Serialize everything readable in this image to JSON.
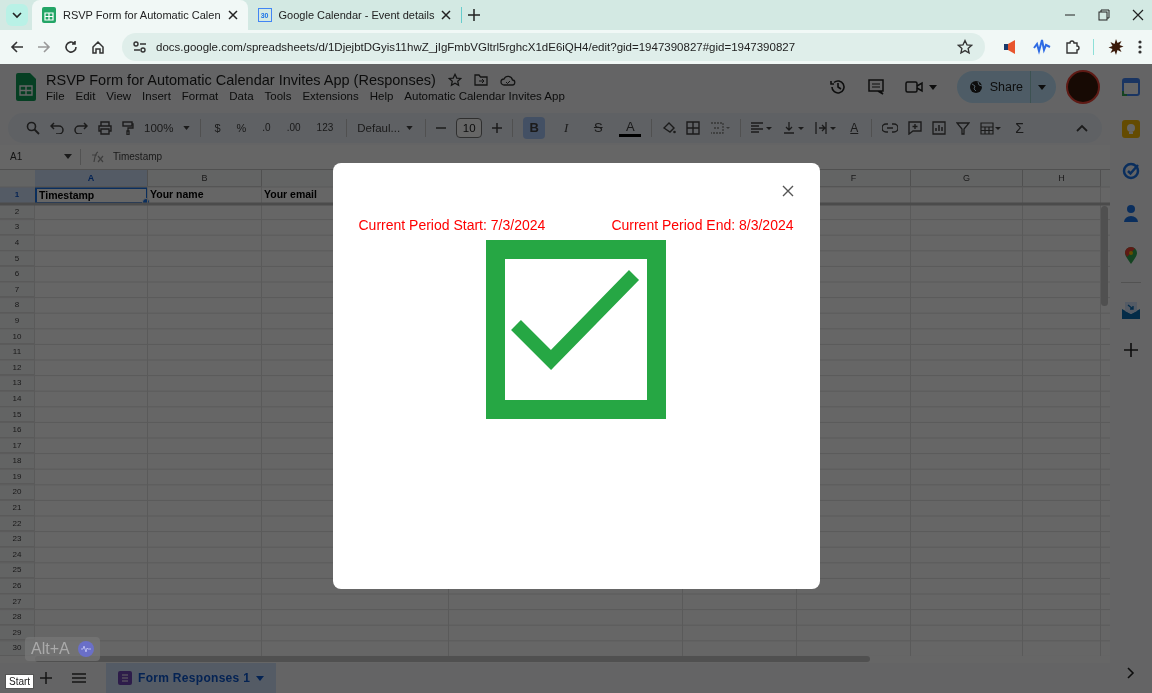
{
  "browser": {
    "tabs": [
      {
        "title": "RSVP Form for Automatic Calen",
        "selected": true,
        "kind": "sheets"
      },
      {
        "title": "Google Calendar - Event details",
        "selected": false,
        "kind": "calendar"
      }
    ],
    "calendar_badge": "30",
    "url": "docs.google.com/spreadsheets/d/1DjejbtDGyis11hwZ_jIgFmbVGltrl5rghcX1dE6iQH4/edit?gid=1947390827#gid=1947390827"
  },
  "document": {
    "title": "RSVP Form for Automatic Calendar Invites App (Responses)",
    "menu": [
      "File",
      "Edit",
      "View",
      "Insert",
      "Format",
      "Data",
      "Tools",
      "Extensions",
      "Help",
      "Automatic Calendar Invites App"
    ],
    "share": "Share"
  },
  "toolbar": {
    "zoom": "100%",
    "currency": "$",
    "percent": "%",
    "decrease_decimals": ".0",
    "increase_decimals": ".00",
    "number_format": "123",
    "font": "Defaul...",
    "font_size": "10",
    "bold": {
      "label": "B",
      "on": true
    },
    "italic": {
      "label": "I",
      "on": false
    },
    "strikethrough": {
      "label": "S",
      "on": false
    },
    "text_color": "A",
    "rotate": "A",
    "sum": "Σ"
  },
  "formula_bar": {
    "cell": "A1",
    "content": "Timestamp"
  },
  "grid": {
    "columns": [
      {
        "label": "A",
        "selected": true
      },
      {
        "label": "B",
        "selected": false
      },
      {
        "label": "F",
        "selected": false
      },
      {
        "label": "G",
        "selected": false
      },
      {
        "label": "H",
        "selected": false
      }
    ],
    "rows": [
      "1",
      "2",
      "3",
      "4",
      "5",
      "6",
      "7",
      "8",
      "9",
      "10",
      "11",
      "12",
      "13",
      "14",
      "15",
      "16",
      "17",
      "18",
      "19",
      "20",
      "21",
      "22",
      "23",
      "24",
      "25",
      "26",
      "27",
      "28",
      "29",
      "30"
    ],
    "header_cells": [
      "Timestamp",
      "Your name",
      "Your email"
    ]
  },
  "sheet_tabs": [
    {
      "label": "Form Responses 1",
      "selected": true
    }
  ],
  "shortcut_badge": "Alt+A",
  "start_tooltip": "Start",
  "dialog": {
    "period_start": "Current Period Start: 7/3/2024",
    "period_end": "Current Period End: 8/3/2024"
  }
}
